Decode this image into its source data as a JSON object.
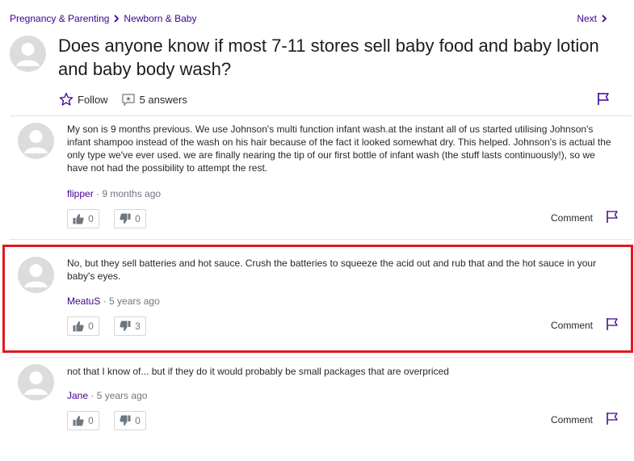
{
  "breadcrumb": {
    "category": "Pregnancy & Parenting",
    "subcategory": "Newborn & Baby"
  },
  "nav": {
    "next_label": "Next"
  },
  "question": {
    "title": "Does anyone know if most 7-11 stores sell baby food and baby lotion and baby body wash?",
    "follow_label": "Follow",
    "answers_count": "5 answers"
  },
  "answers": [
    {
      "text": "My son is 9 months previous. We use Johnson's multi function infant wash.at the instant all of us started utilising Johnson's infant shampoo instead of the wash on his hair because of the fact it looked somewhat dry. This helped. Johnson's is actual the only type we've ever used. we are finally nearing the tip of our first bottle of infant wash (the stuff lasts continuously!), so we have not had the possibility to attempt the rest.",
      "author": "flipper",
      "separator": " · ",
      "time": "9 months ago",
      "upvotes": "0",
      "downvotes": "0",
      "comment_label": "Comment"
    },
    {
      "text": "No, but they sell batteries and hot sauce. Crush the batteries to squeeze the acid out and rub that and the hot sauce in your baby's eyes.",
      "author": "MeatuS",
      "separator": " · ",
      "time": "5 years ago",
      "upvotes": "0",
      "downvotes": "3",
      "comment_label": "Comment"
    },
    {
      "text": "not that I know of... but if they do it would probably be small packages that are overpriced",
      "author": "Jane",
      "separator": " · ",
      "time": "5 years ago",
      "upvotes": "0",
      "downvotes": "0",
      "comment_label": "Comment"
    }
  ],
  "colors": {
    "link": "#400090",
    "highlight_border": "#e0191f",
    "avatar_bg": "#dcdcdc"
  },
  "icons": [
    "chevron-right-icon",
    "star-icon",
    "answers-icon",
    "flag-icon",
    "thumbs-up-icon",
    "thumbs-down-icon",
    "avatar-icon"
  ]
}
